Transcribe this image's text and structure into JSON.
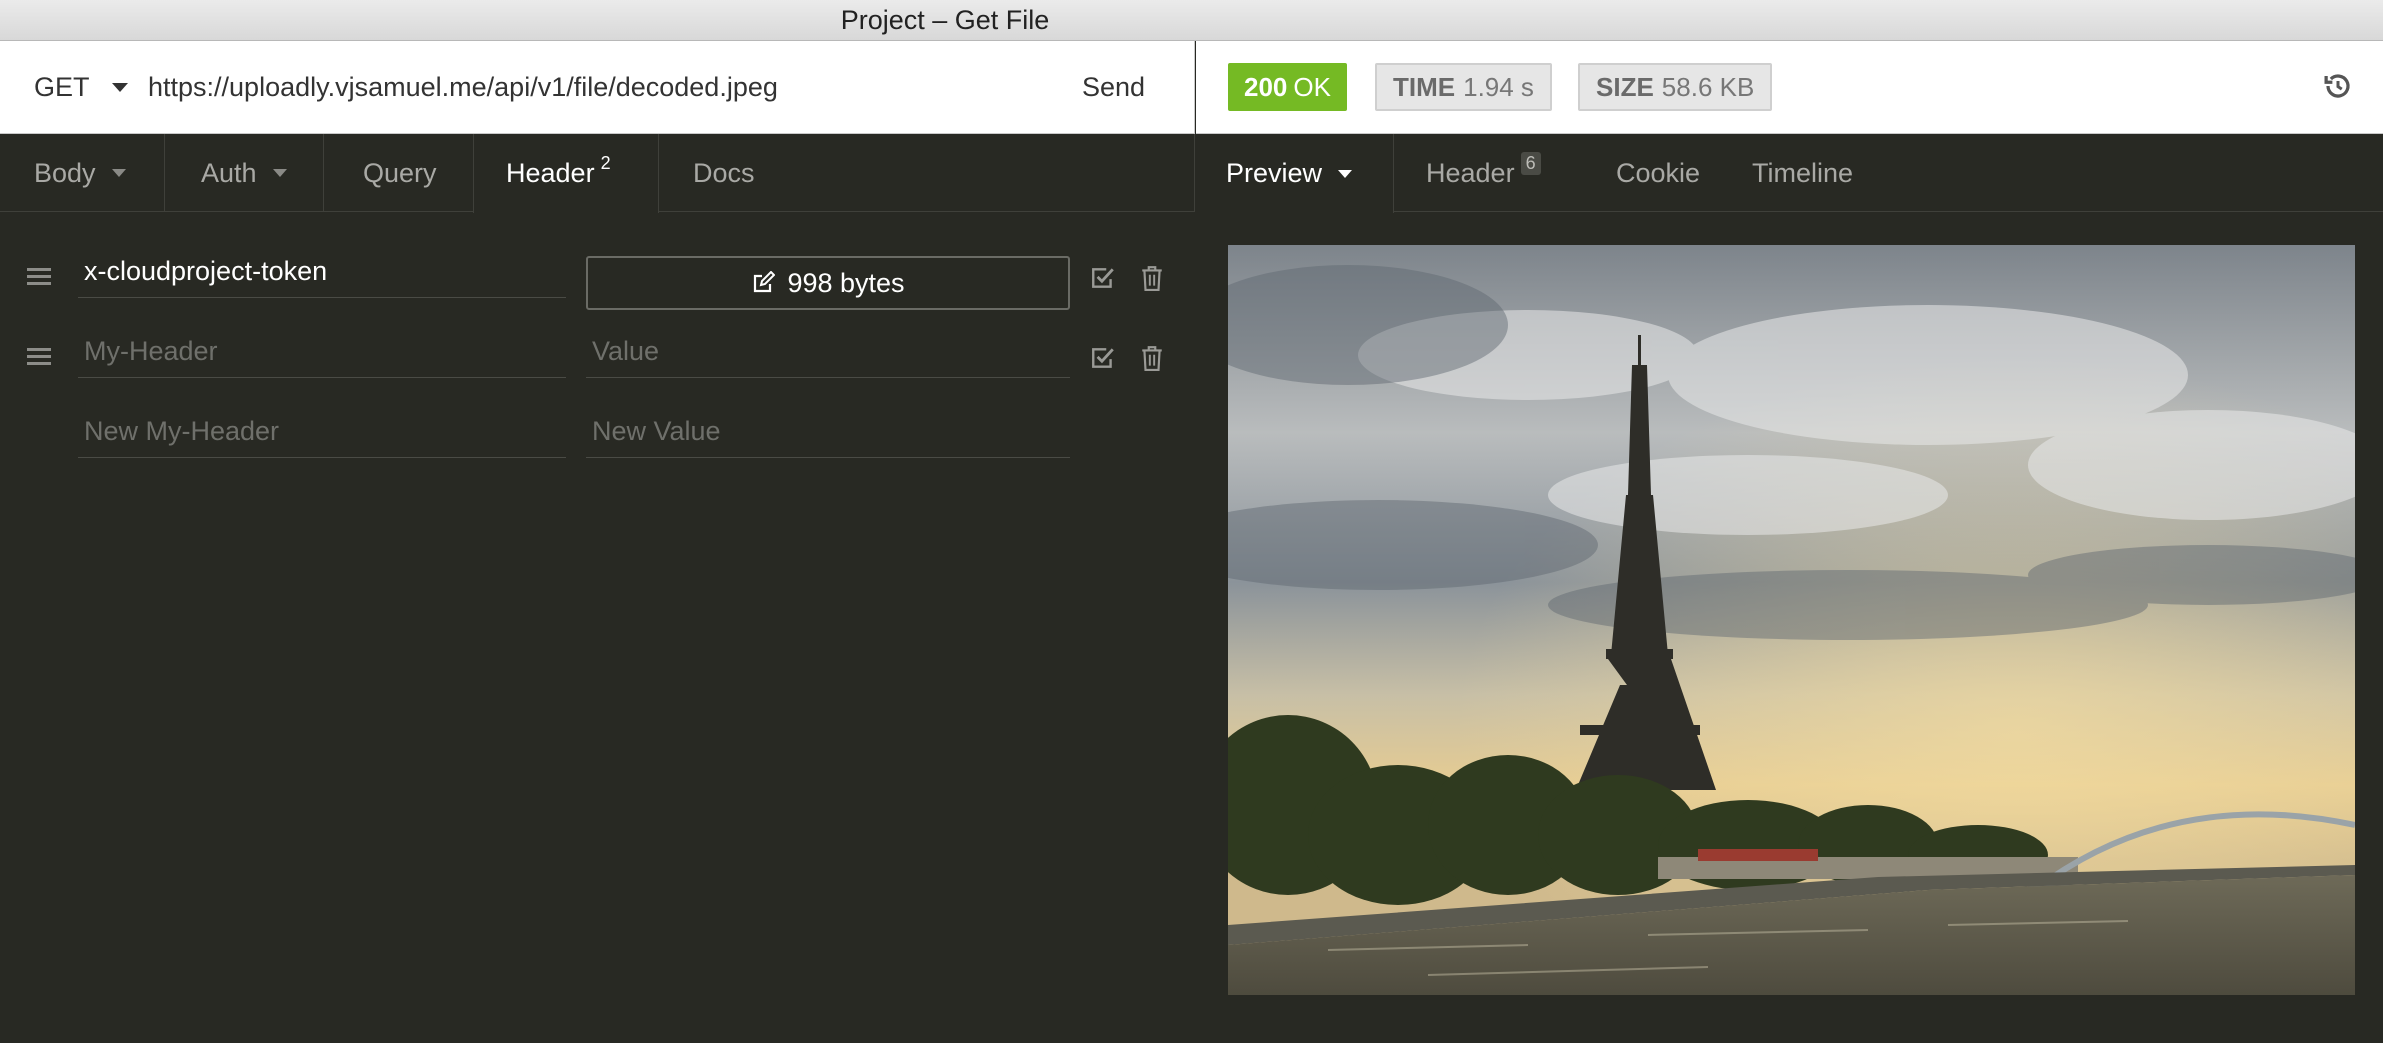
{
  "window": {
    "title": "Project – Get File"
  },
  "request": {
    "method": "GET",
    "url": "https://uploadly.vjsamuel.me/api/v1/file/decoded.jpeg",
    "send_label": "Send",
    "tabs": [
      {
        "label": "Body",
        "dropdown": true
      },
      {
        "label": "Auth",
        "dropdown": true
      },
      {
        "label": "Query"
      },
      {
        "label": "Header",
        "count": "2",
        "active": true
      },
      {
        "label": "Docs"
      }
    ],
    "headers": [
      {
        "name": "x-cloudproject-token",
        "value_button": "998 bytes"
      },
      {
        "name_placeholder": "My-Header",
        "value_placeholder": "Value"
      },
      {
        "name_placeholder": "New My-Header",
        "value_placeholder": "New Value"
      }
    ]
  },
  "response": {
    "status_code": "200",
    "status_text": "OK",
    "status_color": "#75ba24",
    "time_label": "TIME",
    "time_value": "1.94 s",
    "size_label": "SIZE",
    "size_value": "58.6 KB",
    "tabs": [
      {
        "label": "Preview",
        "dropdown": true,
        "active": true
      },
      {
        "label": "Header",
        "count": "6"
      },
      {
        "label": "Cookie"
      },
      {
        "label": "Timeline"
      }
    ],
    "preview_image": "photo of the Eiffel Tower beside the Seine under a cloudy sky"
  },
  "icons": [
    "history-icon",
    "drag-handle-icon",
    "edit-icon",
    "checkbox-icon",
    "trash-icon",
    "chevron-down-icon"
  ]
}
